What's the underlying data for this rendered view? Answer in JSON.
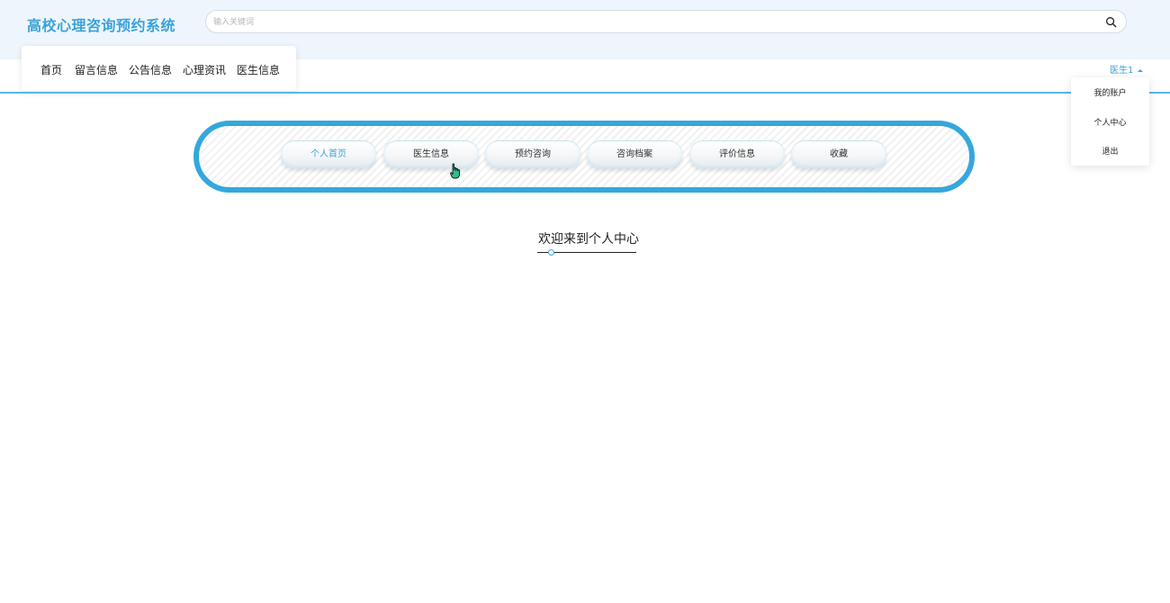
{
  "header": {
    "brand": "高校心理咨询预约系统",
    "search": {
      "placeholder": "输入关键词",
      "value": ""
    }
  },
  "nav": {
    "items": [
      {
        "label": "首页"
      },
      {
        "label": "留言信息"
      },
      {
        "label": "公告信息"
      },
      {
        "label": "心理资讯"
      },
      {
        "label": "医生信息"
      }
    ]
  },
  "user": {
    "name": "医生1",
    "menu": [
      {
        "label": "我的账户"
      },
      {
        "label": "个人中心"
      },
      {
        "label": "退出"
      }
    ]
  },
  "center_menu": {
    "items": [
      {
        "label": "个人首页",
        "active": true
      },
      {
        "label": "医生信息"
      },
      {
        "label": "预约咨询"
      },
      {
        "label": "咨询档案"
      },
      {
        "label": "评价信息"
      },
      {
        "label": "收藏"
      }
    ]
  },
  "welcome": {
    "title": "欢迎来到个人中心"
  },
  "colors": {
    "accent": "#35a7dc",
    "header_bg": "#eef5fc"
  },
  "icons": {
    "search": "search-icon",
    "cursor": "hand-pointer-icon",
    "caret": "caret-up-icon"
  }
}
